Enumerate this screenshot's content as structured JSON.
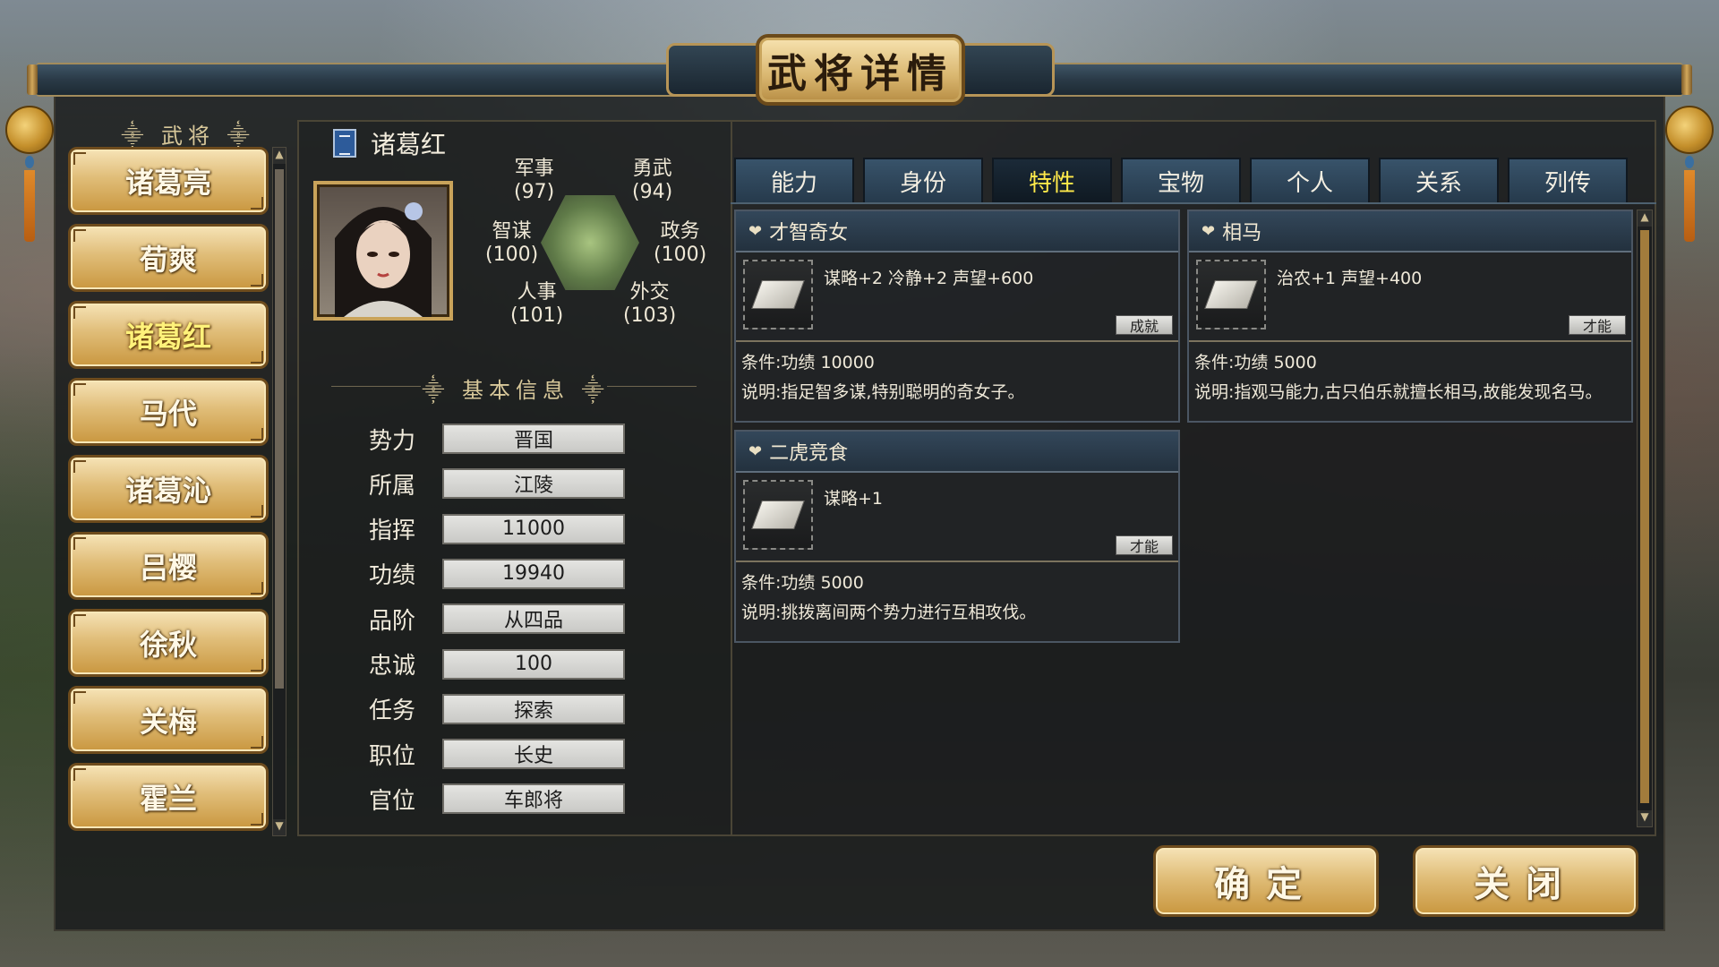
{
  "window_title": "武将详情",
  "list_heading": "武将",
  "generals": [
    {
      "name": "诸葛亮",
      "selected": false
    },
    {
      "name": "荀爽",
      "selected": false
    },
    {
      "name": "诸葛红",
      "selected": true
    },
    {
      "name": "马代",
      "selected": false
    },
    {
      "name": "诸葛沁",
      "selected": false
    },
    {
      "name": "吕樱",
      "selected": false
    },
    {
      "name": "徐秋",
      "selected": false
    },
    {
      "name": "关梅",
      "selected": false
    },
    {
      "name": "霍兰",
      "selected": false
    }
  ],
  "selected_general": {
    "name": "诸葛红",
    "stats": {
      "military": {
        "label": "军事",
        "value": "(97)"
      },
      "valor": {
        "label": "勇武",
        "value": "(94)"
      },
      "strategy": {
        "label": "智谋",
        "value": "(100)"
      },
      "politics": {
        "label": "政务",
        "value": "(100)"
      },
      "personnel": {
        "label": "人事",
        "value": "(101)"
      },
      "diplomacy": {
        "label": "外交",
        "value": "(103)"
      }
    }
  },
  "basic_info_title": "基本信息",
  "basic_info": [
    {
      "label": "势力",
      "value": "晋国"
    },
    {
      "label": "所属",
      "value": "江陵"
    },
    {
      "label": "指挥",
      "value": "11000"
    },
    {
      "label": "功绩",
      "value": "19940"
    },
    {
      "label": "品阶",
      "value": "从四品"
    },
    {
      "label": "忠诚",
      "value": "100"
    },
    {
      "label": "任务",
      "value": "探索"
    },
    {
      "label": "职位",
      "value": "长史"
    },
    {
      "label": "官位",
      "value": "车郎将"
    }
  ],
  "tabs": [
    {
      "label": "能力",
      "active": false
    },
    {
      "label": "身份",
      "active": false
    },
    {
      "label": "特性",
      "active": true
    },
    {
      "label": "宝物",
      "active": false
    },
    {
      "label": "个人",
      "active": false
    },
    {
      "label": "关系",
      "active": false
    },
    {
      "label": "列传",
      "active": false
    }
  ],
  "traits": [
    {
      "name": "才智奇女",
      "effect": "谋略+2 冷静+2 声望+600",
      "tag": "成就",
      "condition": "条件:功绩 10000",
      "description": "说明:指足智多谋,特别聪明的奇女子。"
    },
    {
      "name": "相马",
      "effect": "治农+1 声望+400",
      "tag": "才能",
      "condition": "条件:功绩 5000",
      "description": "说明:指观马能力,古只伯乐就擅长相马,故能发现名马。"
    },
    {
      "name": "二虎竞食",
      "effect": "谋略+1",
      "tag": "才能",
      "condition": "条件:功绩 5000",
      "description": "说明:挑拨离间两个势力进行互相攻伐。"
    }
  ],
  "buttons": {
    "confirm": "确定",
    "close": "关闭"
  },
  "icons": {
    "heart": "heart-icon",
    "scroll_up": "chevron-up-icon",
    "scroll_down": "chevron-down-icon"
  }
}
